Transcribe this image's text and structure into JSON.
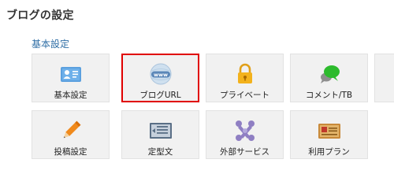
{
  "page_title": "ブログの設定",
  "section_title": "基本設定",
  "tiles": [
    {
      "label": "基本設定",
      "icon": "id-card-icon",
      "selected": false
    },
    {
      "label": "ブログURL",
      "icon": "globe-www-icon",
      "selected": true
    },
    {
      "label": "プライベート",
      "icon": "padlock-icon",
      "selected": false
    },
    {
      "label": "コメント/TB",
      "icon": "speech-bubbles-icon",
      "selected": false
    },
    {
      "label": "",
      "icon": "",
      "selected": false
    },
    {
      "label": "投稿設定",
      "icon": "pencil-icon",
      "selected": false
    },
    {
      "label": "定型文",
      "icon": "text-template-icon",
      "selected": false
    },
    {
      "label": "外部サービス",
      "icon": "puzzle-joomla-icon",
      "selected": false
    },
    {
      "label": "利用プラン",
      "icon": "ticket-card-icon",
      "selected": false
    }
  ],
  "colors": {
    "selected_border": "#e00000",
    "section_title": "#2f6ea5",
    "tile_bg": "#f1f1f1"
  }
}
